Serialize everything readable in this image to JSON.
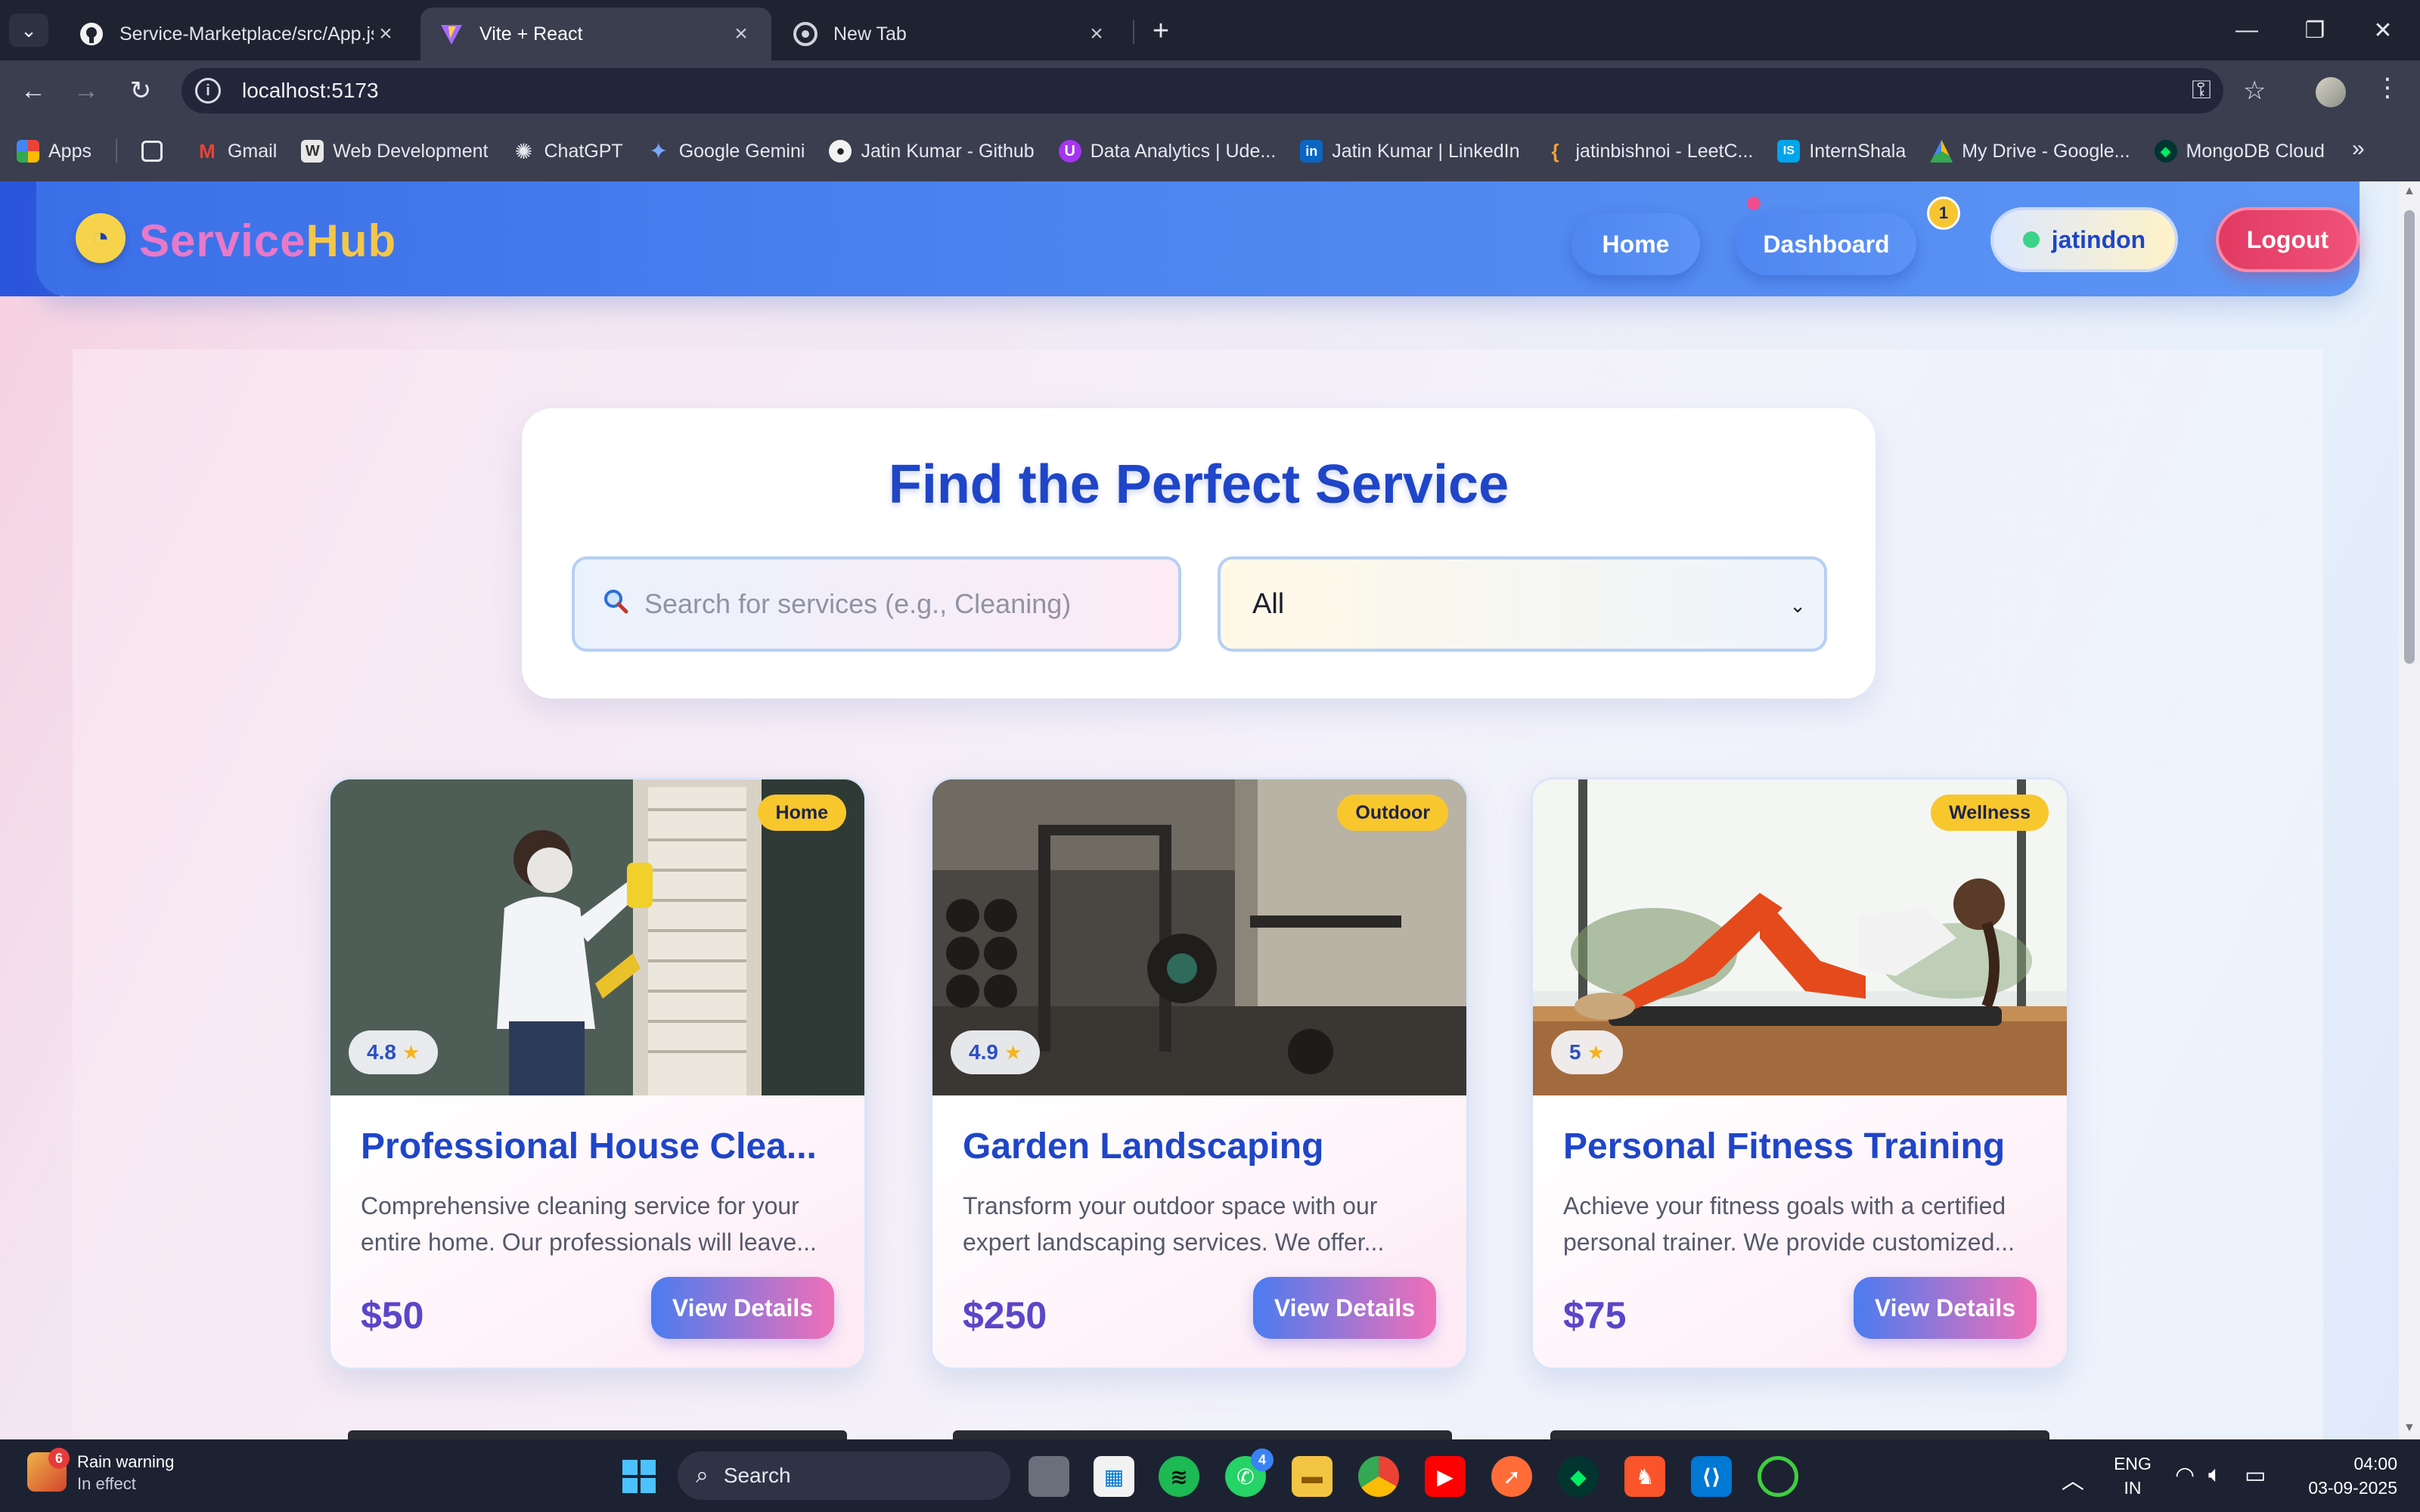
{
  "browser": {
    "tabs": [
      {
        "title": "Service-Marketplace/src/App.jsx",
        "favicon": "github-icon"
      },
      {
        "title": "Vite + React",
        "favicon": "vite-icon"
      },
      {
        "title": "New Tab",
        "favicon": "chrome-icon"
      }
    ],
    "url": "localhost:5173",
    "bookmarks": [
      {
        "label": "Apps",
        "icon": "apps-grid-icon"
      },
      {
        "label": "Gmail",
        "icon": "gmail-icon"
      },
      {
        "label": "Web Development",
        "icon": "web-icon"
      },
      {
        "label": "ChatGPT",
        "icon": "chatgpt-icon"
      },
      {
        "label": "Google Gemini",
        "icon": "gemini-icon"
      },
      {
        "label": "Jatin Kumar - Github",
        "icon": "github-icon"
      },
      {
        "label": "Data Analytics | Ude...",
        "icon": "udemy-icon"
      },
      {
        "label": "Jatin Kumar | LinkedIn",
        "icon": "linkedin-icon"
      },
      {
        "label": "jatinbishnoi - LeetC...",
        "icon": "leetcode-icon"
      },
      {
        "label": "InternShala",
        "icon": "internshala-icon"
      },
      {
        "label": "My Drive - Google...",
        "icon": "drive-icon"
      },
      {
        "label": "MongoDB Cloud",
        "icon": "mongodb-icon"
      }
    ]
  },
  "app": {
    "brand_part1": "Service",
    "brand_part2": "Hub",
    "nav": {
      "home": "Home",
      "dashboard": "Dashboard",
      "dashboard_badge": "1",
      "username": "jatindon",
      "logout": "Logout"
    },
    "search": {
      "title": "Find the Perfect Service",
      "placeholder": "Search for services (e.g., Cleaning)",
      "category_selected": "All"
    },
    "services": [
      {
        "title": "Professional House Clea...",
        "category": "Home",
        "rating": "4.8",
        "description": "Comprehensive cleaning service for your entire home. Our professionals will leave...",
        "price": "$50",
        "cta": "View Details"
      },
      {
        "title": "Garden Landscaping",
        "category": "Outdoor",
        "rating": "4.9",
        "description": "Transform your outdoor space with our expert landscaping services. We offer...",
        "price": "$250",
        "cta": "View Details"
      },
      {
        "title": "Personal Fitness Training",
        "category": "Wellness",
        "rating": "5",
        "description": "Achieve your fitness goals with a certified personal trainer. We provide customized...",
        "price": "$75",
        "cta": "View Details"
      }
    ]
  },
  "taskbar": {
    "weather_title": "Rain warning",
    "weather_sub": "In effect",
    "weather_badge": "6",
    "search_label": "Search",
    "whatsapp_badge": "4",
    "lang_top": "ENG",
    "lang_bottom": "IN",
    "time": "04:00",
    "date": "03-09-2025"
  },
  "colors": {
    "brand_blue": "#1f45c8",
    "header_blue": "#4b82ef",
    "logout_red": "#e13a63",
    "tag_yellow": "#f8c72d"
  }
}
